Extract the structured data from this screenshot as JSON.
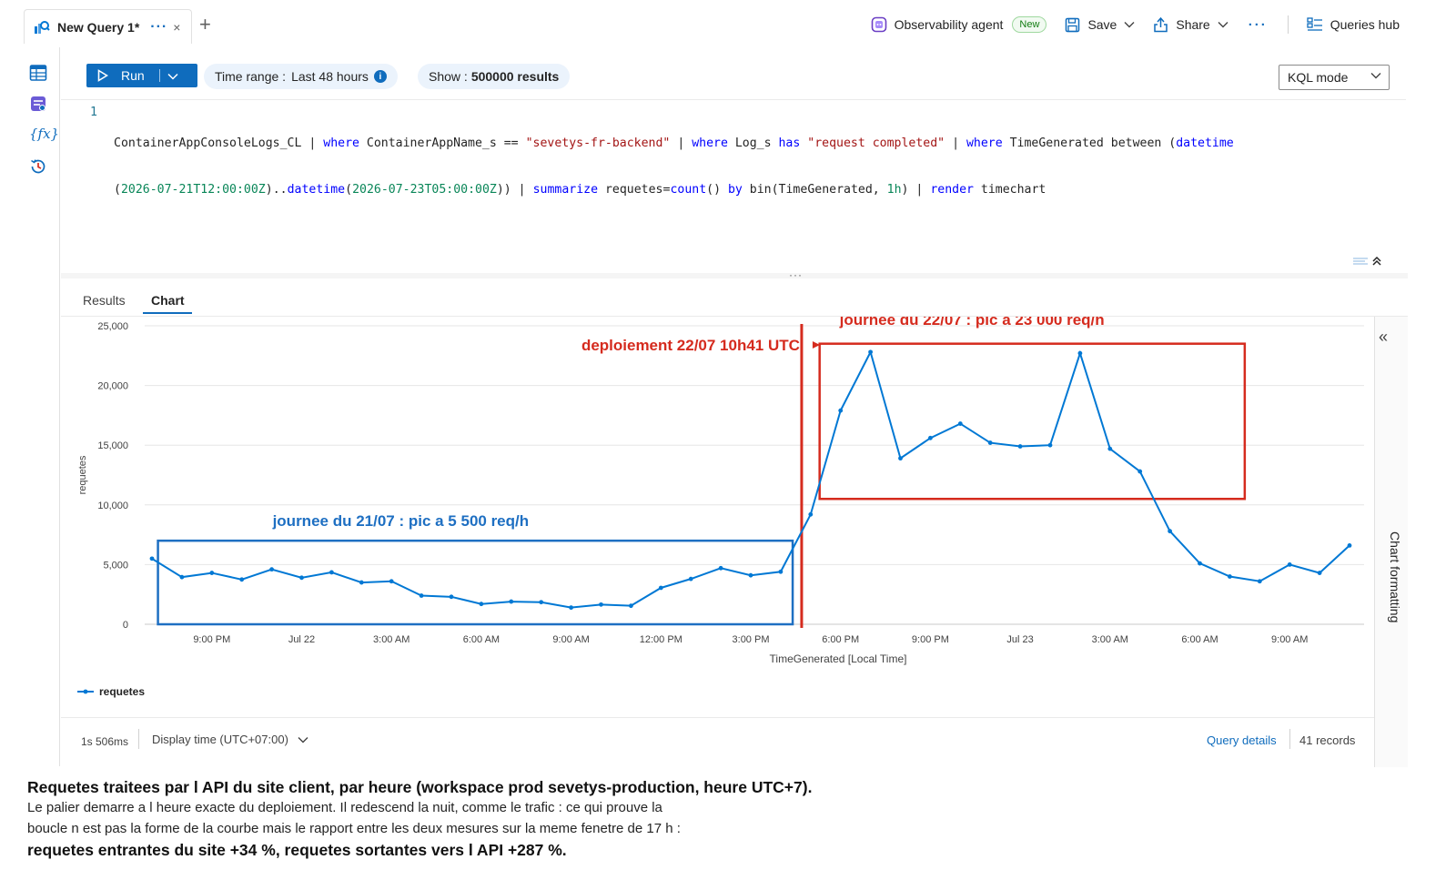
{
  "tab": {
    "title": "New Query 1*",
    "more": "···",
    "close": "×",
    "new": "+"
  },
  "toolbar": {
    "agent_label": "Observability agent",
    "agent_badge": "New",
    "save_label": "Save",
    "share_label": "Share",
    "more": "···",
    "hub_label": "Queries hub"
  },
  "command_bar": {
    "run_label": "Run",
    "time_range_label": "Time range :",
    "time_range_value": "Last 48 hours",
    "show_label": "Show :",
    "show_value": "500000 results",
    "mode_value": "KQL mode"
  },
  "editor": {
    "line_number": "1",
    "tokens_line1": [
      {
        "t": "ContainerAppConsoleLogs_CL | ",
        "c": ""
      },
      {
        "t": "where",
        "c": "kw"
      },
      {
        "t": " ContainerAppName_s == ",
        "c": ""
      },
      {
        "t": "\"sevetys-fr-backend\"",
        "c": "str"
      },
      {
        "t": " | ",
        "c": ""
      },
      {
        "t": "where",
        "c": "kw"
      },
      {
        "t": " Log_s ",
        "c": ""
      },
      {
        "t": "has",
        "c": "kw"
      },
      {
        "t": " ",
        "c": ""
      },
      {
        "t": "\"request completed\"",
        "c": "str"
      },
      {
        "t": " | ",
        "c": ""
      },
      {
        "t": "where",
        "c": "kw"
      },
      {
        "t": " TimeGenerated between (",
        "c": ""
      },
      {
        "t": "datetime",
        "c": "fn"
      }
    ],
    "tokens_line2": [
      {
        "t": "(",
        "c": ""
      },
      {
        "t": "2026-07-21T12:00:00Z",
        "c": "num"
      },
      {
        "t": ")..",
        "c": ""
      },
      {
        "t": "datetime",
        "c": "fn"
      },
      {
        "t": "(",
        "c": ""
      },
      {
        "t": "2026-07-23T05:00:00Z",
        "c": "num"
      },
      {
        "t": ")) | ",
        "c": ""
      },
      {
        "t": "summarize",
        "c": "kw"
      },
      {
        "t": " requetes=",
        "c": ""
      },
      {
        "t": "count",
        "c": "fn"
      },
      {
        "t": "() ",
        "c": ""
      },
      {
        "t": "by",
        "c": "kw"
      },
      {
        "t": " bin(TimeGenerated, ",
        "c": ""
      },
      {
        "t": "1h",
        "c": "num"
      },
      {
        "t": ") | ",
        "c": ""
      },
      {
        "t": "render",
        "c": "kw"
      },
      {
        "t": " timechart",
        "c": ""
      }
    ]
  },
  "results_tabs": [
    {
      "label": "Results"
    },
    {
      "label": "Chart"
    }
  ],
  "chart_data": {
    "type": "line",
    "xlabel": "TimeGenerated [Local Time]",
    "ylabel": "requetes",
    "ylim": [
      0,
      25000
    ],
    "yticks": [
      0,
      5000,
      10000,
      15000,
      20000,
      25000
    ],
    "ytick_labels": [
      "0",
      "5,000",
      "10,000",
      "15,000",
      "20,000",
      "25,000"
    ],
    "xtick_labels": [
      "9:00 PM",
      "Jul 22",
      "3:00 AM",
      "6:00 AM",
      "9:00 AM",
      "12:00 PM",
      "3:00 PM",
      "6:00 PM",
      "9:00 PM",
      "Jul 23",
      "3:00 AM",
      "6:00 AM",
      "9:00 AM"
    ],
    "xtick_hours": [
      2,
      5,
      8,
      11,
      14,
      17,
      20,
      23,
      26,
      29,
      32,
      35,
      38
    ],
    "grid": true,
    "legend_position": "bottom-left",
    "series": [
      {
        "name": "requetes",
        "color": "#0078d4",
        "values": [
          5500,
          3950,
          4300,
          3750,
          4600,
          3900,
          4350,
          3500,
          3600,
          2400,
          2300,
          1700,
          1900,
          1850,
          1400,
          1650,
          1550,
          3050,
          3800,
          4700,
          4100,
          4400,
          9200,
          17900,
          22800,
          13900,
          15600,
          16800,
          15200,
          14900,
          15000,
          22700,
          14700,
          12800,
          7800,
          5100,
          4000,
          3600,
          5000,
          4300,
          6600
        ]
      }
    ],
    "annotations": {
      "deploy_label": "deploiement 22/07 10h41 UTC",
      "deploy_hour": 21.7,
      "box_day2_label": "journee du 22/07 : pic a 23 000 req/h",
      "box_day2": {
        "from_hour": 22.3,
        "to_hour": 36.5,
        "y_from": 10500,
        "y_to": 23500
      },
      "box_day1_label": "journee du 21/07 : pic a 5 500 req/h",
      "box_day1": {
        "from_hour": 0.2,
        "to_hour": 21.4,
        "y_from": 0,
        "y_to": 7000
      },
      "annotation_color_red": "#d52b1e",
      "annotation_color_blue": "#1e6fc2"
    }
  },
  "chart_panel": {
    "title": "Chart formatting",
    "collapse": "«"
  },
  "status_bar": {
    "duration": "1s 506ms",
    "display_time": "Display time (UTC+07:00)",
    "query_details": "Query details",
    "records": "41 records"
  },
  "caption": {
    "title": "Requetes traitees par l API du site client, par heure (workspace prod sevetys-production, heure UTC+7).",
    "line1": "Le palier demarre a l heure exacte du deploiement. Il redescend la nuit, comme le trafic : ce qui prouve la",
    "line2": "boucle n est pas la forme de la courbe mais le rapport entre les deux mesures sur la meme fenetre de 17 h :",
    "line3": "requetes entrantes du site +34 %, requetes sortantes vers l API +287 %."
  }
}
